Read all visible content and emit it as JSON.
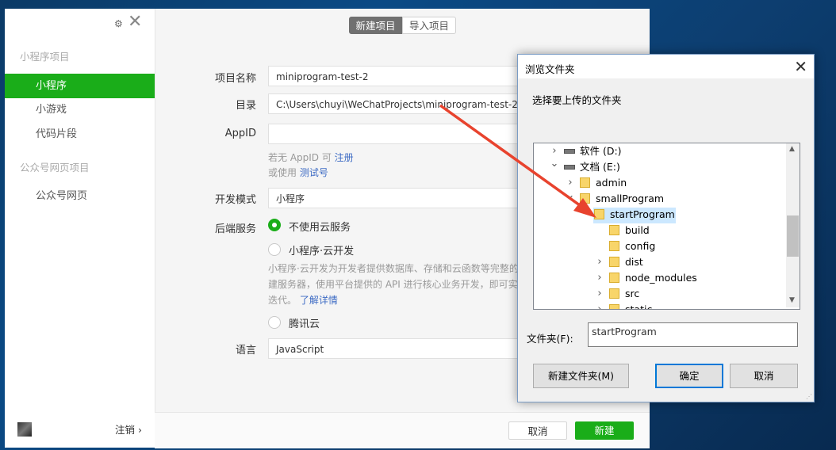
{
  "sidebar": {
    "sections": [
      {
        "title": "小程序项目"
      },
      {
        "title": "公众号网页项目"
      }
    ],
    "items": [
      {
        "label": "小程序",
        "active": true
      },
      {
        "label": "小游戏"
      },
      {
        "label": "代码片段"
      },
      {
        "label": "公众号网页"
      }
    ],
    "logout_label": "注销 ›"
  },
  "tabs": [
    {
      "label": "新建项目",
      "active": true
    },
    {
      "label": "导入项目"
    }
  ],
  "form": {
    "project_name": {
      "label": "项目名称",
      "value": "miniprogram-test-2"
    },
    "directory": {
      "label": "目录",
      "value": "C:\\Users\\chuyi\\WeChatProjects\\miniprogram-test-2"
    },
    "appid": {
      "label": "AppID",
      "value": "",
      "hint1_prefix": "若无 AppID 可 ",
      "hint1_link": "注册",
      "hint2_prefix": "或使用 ",
      "hint2_link": "测试号"
    },
    "dev_mode": {
      "label": "开发模式",
      "value": "小程序"
    },
    "backend": {
      "label": "后端服务",
      "options": [
        {
          "label": "不使用云服务",
          "selected": true
        },
        {
          "label": "小程序·云开发"
        },
        {
          "label": "腾讯云"
        }
      ],
      "desc_lines": [
        "小程序·云开发为开发者提供数据库、存储和云函数等完整的",
        "建服务器，使用平台提供的 API 进行核心业务开发，即可实"
      ],
      "desc_last": "迭代。",
      "desc_link": "了解详情"
    },
    "language": {
      "label": "语言",
      "value": "JavaScript"
    }
  },
  "footer": {
    "cancel_label": "取消",
    "create_label": "新建"
  },
  "dialog": {
    "title": "浏览文件夹",
    "prompt": "选择要上传的文件夹",
    "tree": [
      {
        "label": "软件 (D:)",
        "type": "drive",
        "expander": "›",
        "level": 0
      },
      {
        "label": "文档 (E:)",
        "type": "drive",
        "expander": "⌄",
        "level": 0
      },
      {
        "label": "admin",
        "type": "folder",
        "expander": "›",
        "level": 1
      },
      {
        "label": "smallProgram",
        "type": "folder",
        "expander": "⌄",
        "level": 1
      },
      {
        "label": "startProgram",
        "type": "folder",
        "expander": "⌄",
        "level": 2,
        "selected": true
      },
      {
        "label": "build",
        "type": "folder",
        "expander": "",
        "level": 3
      },
      {
        "label": "config",
        "type": "folder",
        "expander": "",
        "level": 3
      },
      {
        "label": "dist",
        "type": "folder",
        "expander": "›",
        "level": 3
      },
      {
        "label": "node_modules",
        "type": "folder",
        "expander": "›",
        "level": 3
      },
      {
        "label": "src",
        "type": "folder",
        "expander": "›",
        "level": 3
      },
      {
        "label": "static",
        "type": "folder",
        "expander": "›",
        "level": 3
      }
    ],
    "folder_label": "文件夹(F):",
    "folder_value": "startProgram",
    "new_folder_label": "新建文件夹(M)",
    "ok_label": "确定",
    "cancel_label": "取消"
  },
  "colors": {
    "accent": "#1aad19",
    "arrow": "#e8432e",
    "link": "#3d6bc4"
  }
}
